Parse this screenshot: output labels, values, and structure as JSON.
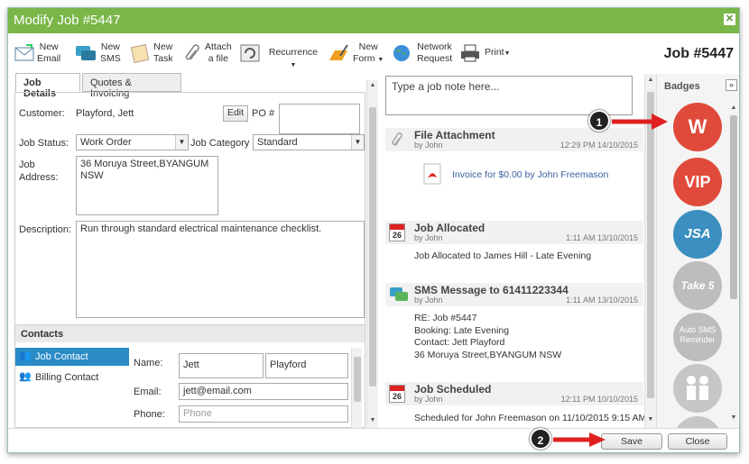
{
  "window": {
    "title": "Modify Job #5447",
    "job_heading": "Job #5447"
  },
  "toolbar": {
    "new_email": [
      "New",
      "Email"
    ],
    "new_sms": [
      "New",
      "SMS"
    ],
    "new_task": [
      "New",
      "Task"
    ],
    "attach_file": [
      "Attach",
      "a file"
    ],
    "recurrence": "Recurrence",
    "new_form": [
      "New",
      "Form"
    ],
    "network_request": [
      "Network",
      "Request"
    ],
    "print": "Print"
  },
  "tabs": [
    {
      "label": "Job Details",
      "active": true
    },
    {
      "label": "Quotes & Invoicing",
      "active": false
    }
  ],
  "details": {
    "customer_label": "Customer:",
    "customer_value": "Playford, Jett",
    "edit_label": "Edit",
    "po_label": "PO #",
    "po_value": "",
    "status_label": "Job Status:",
    "status_value": "Work Order",
    "category_label": "Job Category",
    "category_value": "Standard",
    "address_label": [
      "Job",
      "Address:"
    ],
    "address_value": [
      "36 Moruya Street,BYANGUM",
      "NSW"
    ],
    "description_label": "Description:",
    "description_value": "Run through standard electrical maintenance checklist."
  },
  "contacts": {
    "header": "Contacts",
    "items": [
      {
        "label": "Job Contact",
        "selected": true
      },
      {
        "label": "Billing Contact",
        "selected": false
      }
    ],
    "name_label": "Name:",
    "first_name": "Jett",
    "last_name": "Playford",
    "email_label": "Email:",
    "email_value": "jett@email.com",
    "phone_label": "Phone:",
    "phone_placeholder": "Phone"
  },
  "feed": {
    "note_placeholder": "Type a job note here...",
    "entries": [
      {
        "title": "File Attachment",
        "by": "by John",
        "date": "12:29 PM 14/10/2015",
        "body": [
          "Invoice for $0.00 by John Freemason"
        ]
      },
      {
        "title": "Job Allocated",
        "by": "by John",
        "date": "1:11 AM 13/10/2015",
        "body": [
          "Job Allocated to James Hill - Late Evening"
        ]
      },
      {
        "title": "SMS Message to 61411223344",
        "by": "by John",
        "date": "1:11 AM 13/10/2015",
        "body": [
          "RE: Job #5447",
          "Booking: Late Evening",
          "Contact: Jett Playford",
          "36 Moruya Street,BYANGUM NSW"
        ]
      },
      {
        "title": "Job Scheduled",
        "by": "by John",
        "date": "12:11 PM 10/10/2015",
        "body": [
          "Scheduled for John Freemason on 11/10/2015 9:15 AM"
        ]
      }
    ],
    "calendar_day": "26"
  },
  "badges": {
    "header": "Badges",
    "items": [
      {
        "label": "W",
        "color": "#e04a3b"
      },
      {
        "label": "VIP",
        "color": "#e04a3b"
      },
      {
        "label": "JSA",
        "color": "#3a8fc0"
      },
      {
        "label": "Take 5",
        "color": "#bdbdbd"
      },
      {
        "label": "Auto SMS Reminder",
        "color": "#bdbdbd"
      },
      {
        "label": "",
        "color": "#c6c6c6"
      }
    ]
  },
  "footer": {
    "save_label": "Save",
    "close_label": "Close"
  },
  "annotations": {
    "marker_1": "1",
    "marker_2": "2"
  }
}
